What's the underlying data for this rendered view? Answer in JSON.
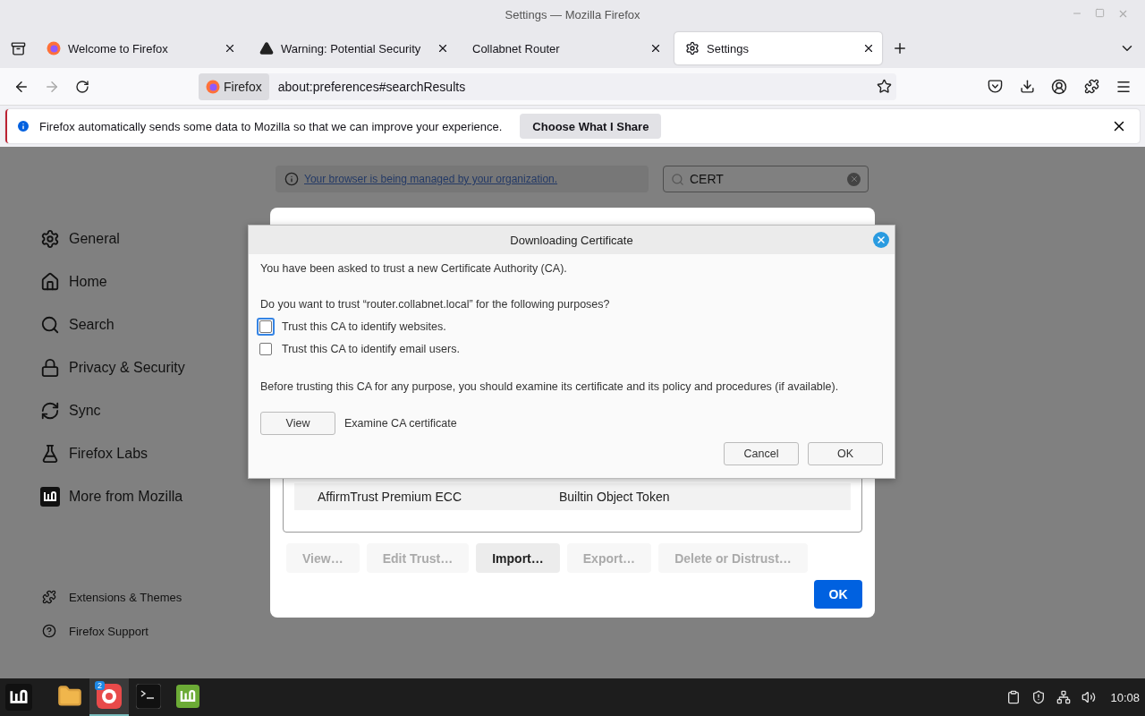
{
  "window": {
    "title": "Settings — Mozilla Firefox"
  },
  "tabs": [
    {
      "kind": "firefox",
      "label": "Welcome to Firefox",
      "selected": false
    },
    {
      "kind": "warning",
      "label": "Warning: Potential Security",
      "selected": false
    },
    {
      "kind": "plain",
      "label": "Collabnet Router",
      "selected": false
    },
    {
      "kind": "gear",
      "label": "Settings",
      "selected": true
    }
  ],
  "url_bar": {
    "identity": "Firefox",
    "url": "about:preferences#searchResults"
  },
  "notification": {
    "message": "Firefox automatically sends some data to Mozilla so that we can improve your experience.",
    "button": "Choose What I Share"
  },
  "sidebar": {
    "items": [
      {
        "kind": "general",
        "label": "General"
      },
      {
        "kind": "home",
        "label": "Home"
      },
      {
        "kind": "search",
        "label": "Search"
      },
      {
        "kind": "privacy",
        "label": "Privacy & Security"
      },
      {
        "kind": "sync",
        "label": "Sync"
      },
      {
        "kind": "labs",
        "label": "Firefox Labs"
      },
      {
        "kind": "mozilla",
        "label": "More from Mozilla"
      }
    ],
    "footer": [
      {
        "kind": "extensions",
        "label": "Extensions & Themes"
      },
      {
        "kind": "support",
        "label": "Firefox Support"
      }
    ]
  },
  "managed_notice": "Your browser is being managed by your organization.",
  "search": {
    "value": "CERT"
  },
  "certificate_manager": {
    "rows": [
      {
        "name": "AffirmTrust Premium ECC",
        "device": "Builtin Object Token"
      }
    ],
    "buttons": [
      {
        "label": "View…",
        "disabled": true
      },
      {
        "label": "Edit Trust…",
        "disabled": true
      },
      {
        "label": "Import…",
        "disabled": false
      },
      {
        "label": "Export…",
        "disabled": true
      },
      {
        "label": "Delete or Distrust…",
        "disabled": true
      }
    ],
    "ok": "OK"
  },
  "download_dialog": {
    "title": "Downloading Certificate",
    "intro": "You have been asked to trust a new Certificate Authority (CA).",
    "question": "Do you want to trust “router.collabnet.local” for the following purposes?",
    "options": [
      {
        "label": "Trust this CA to identify websites.",
        "checked": false,
        "focused": true
      },
      {
        "label": "Trust this CA to identify email users.",
        "checked": false,
        "focused": false
      }
    ],
    "advice": "Before trusting this CA for any purpose, you should examine its certificate and its policy and procedures (if available).",
    "view_button": "View",
    "view_label": "Examine CA certificate",
    "cancel": "Cancel",
    "ok": "OK"
  },
  "taskbar": {
    "apps": [
      {
        "kind": "files",
        "active": false
      },
      {
        "kind": "firefox",
        "badge": "2",
        "active": true
      },
      {
        "kind": "terminal",
        "active": false
      },
      {
        "kind": "mint",
        "active": false
      }
    ],
    "time": "10:08"
  }
}
